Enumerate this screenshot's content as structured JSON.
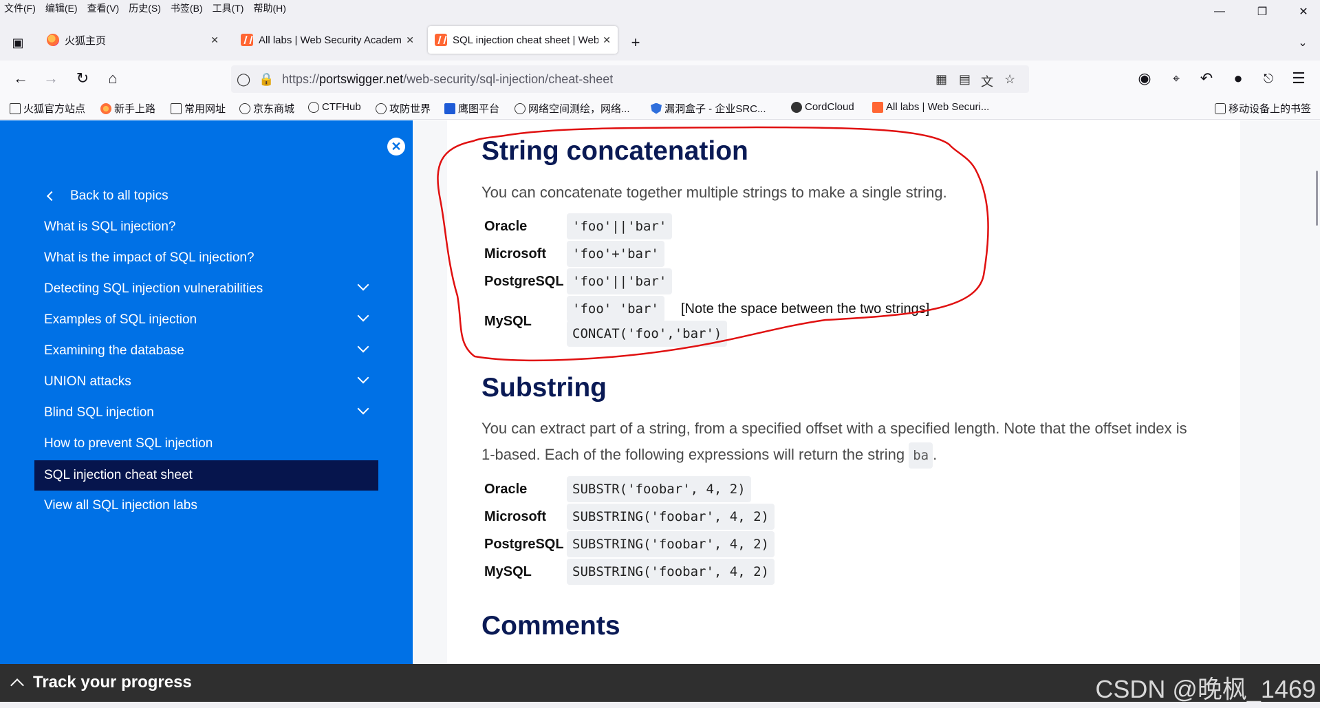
{
  "menubar": {
    "items": [
      "文件(F)",
      "编辑(E)",
      "查看(V)",
      "历史(S)",
      "书签(B)",
      "工具(T)",
      "帮助(H)"
    ]
  },
  "tabs": [
    {
      "title": "火狐主页",
      "icon": "firefox-icon"
    },
    {
      "title": "All labs | Web Security Academy",
      "icon": "portswigger-icon"
    },
    {
      "title": "SQL injection cheat sheet | Web Security Academy",
      "icon": "portswigger-icon",
      "active": true
    }
  ],
  "address_bar": {
    "url_prefix": "https://",
    "url_domain": "portswigger.net",
    "url_path": "/web-security/sql-injection/cheat-sheet"
  },
  "bookmarks": [
    {
      "label": "火狐官方站点",
      "icon": "folder-icon"
    },
    {
      "label": "新手上路",
      "icon": "firefox-icon"
    },
    {
      "label": "常用网址",
      "icon": "folder-icon"
    },
    {
      "label": "京东商城",
      "icon": "globe-icon"
    },
    {
      "label": "CTFHub",
      "icon": "ctfhub-icon"
    },
    {
      "label": "攻防世界",
      "icon": "globe-icon"
    },
    {
      "label": "鹰图平台",
      "icon": "hunter-icon"
    },
    {
      "label": "网络空间测绘，网络...",
      "icon": "fofa-icon"
    },
    {
      "label": "漏洞盒子 - 企业SRC...",
      "icon": "shield-icon"
    },
    {
      "label": "CordCloud",
      "icon": "cordcloud-icon"
    },
    {
      "label": "All labs | Web Securi...",
      "icon": "portswigger-icon"
    },
    {
      "label": "移动设备上的书签",
      "icon": "mobile-device-icon"
    }
  ],
  "sidebar": {
    "back_label": "Back to all topics",
    "items": [
      {
        "label": "What is SQL injection?",
        "expandable": false
      },
      {
        "label": "What is the impact of SQL injection?",
        "expandable": false
      },
      {
        "label": "Detecting SQL injection vulnerabilities",
        "expandable": true
      },
      {
        "label": "Examples of SQL injection",
        "expandable": true
      },
      {
        "label": "Examining the database",
        "expandable": true
      },
      {
        "label": "UNION attacks",
        "expandable": true
      },
      {
        "label": "Blind SQL injection",
        "expandable": true
      },
      {
        "label": "How to prevent SQL injection",
        "expandable": false
      },
      {
        "label": "SQL injection cheat sheet",
        "expandable": false,
        "active": true
      },
      {
        "label": "View all SQL injection labs",
        "expandable": false
      }
    ]
  },
  "string_concat": {
    "heading": "String concatenation",
    "description": "You can concatenate together multiple strings to make a single string.",
    "rows": [
      {
        "db": "Oracle",
        "code": "'foo'||'bar'"
      },
      {
        "db": "Microsoft",
        "code": "'foo'+'bar'"
      },
      {
        "db": "PostgreSQL",
        "code": "'foo'||'bar'"
      },
      {
        "db": "MySQL",
        "code": "'foo' 'bar'",
        "note": "[Note the space between the two strings]",
        "code2": "CONCAT('foo','bar')"
      }
    ]
  },
  "substring": {
    "heading": "Substring",
    "description_line1": "You can extract part of a string, from a specified offset with a specified length. Note that the offset index is",
    "description_line2": "1-based. Each of the following expressions will return the string",
    "example_value": "ba",
    "rows": [
      {
        "db": "Oracle",
        "code": "SUBSTR('foobar', 4, 2)"
      },
      {
        "db": "Microsoft",
        "code": "SUBSTRING('foobar', 4, 2)"
      },
      {
        "db": "PostgreSQL",
        "code": "SUBSTRING('foobar', 4, 2)"
      },
      {
        "db": "MySQL",
        "code": "SUBSTRING('foobar', 4, 2)"
      }
    ]
  },
  "comments": {
    "heading": "Comments"
  },
  "bottom_bar": {
    "label": "Track your progress",
    "watermark": "CSDN @晚枫_1469"
  },
  "colors": {
    "sidebar_bg": "#0071e6",
    "sidebar_active": "#06154d",
    "heading": "#0a1a55",
    "annotation": "#e01010"
  }
}
